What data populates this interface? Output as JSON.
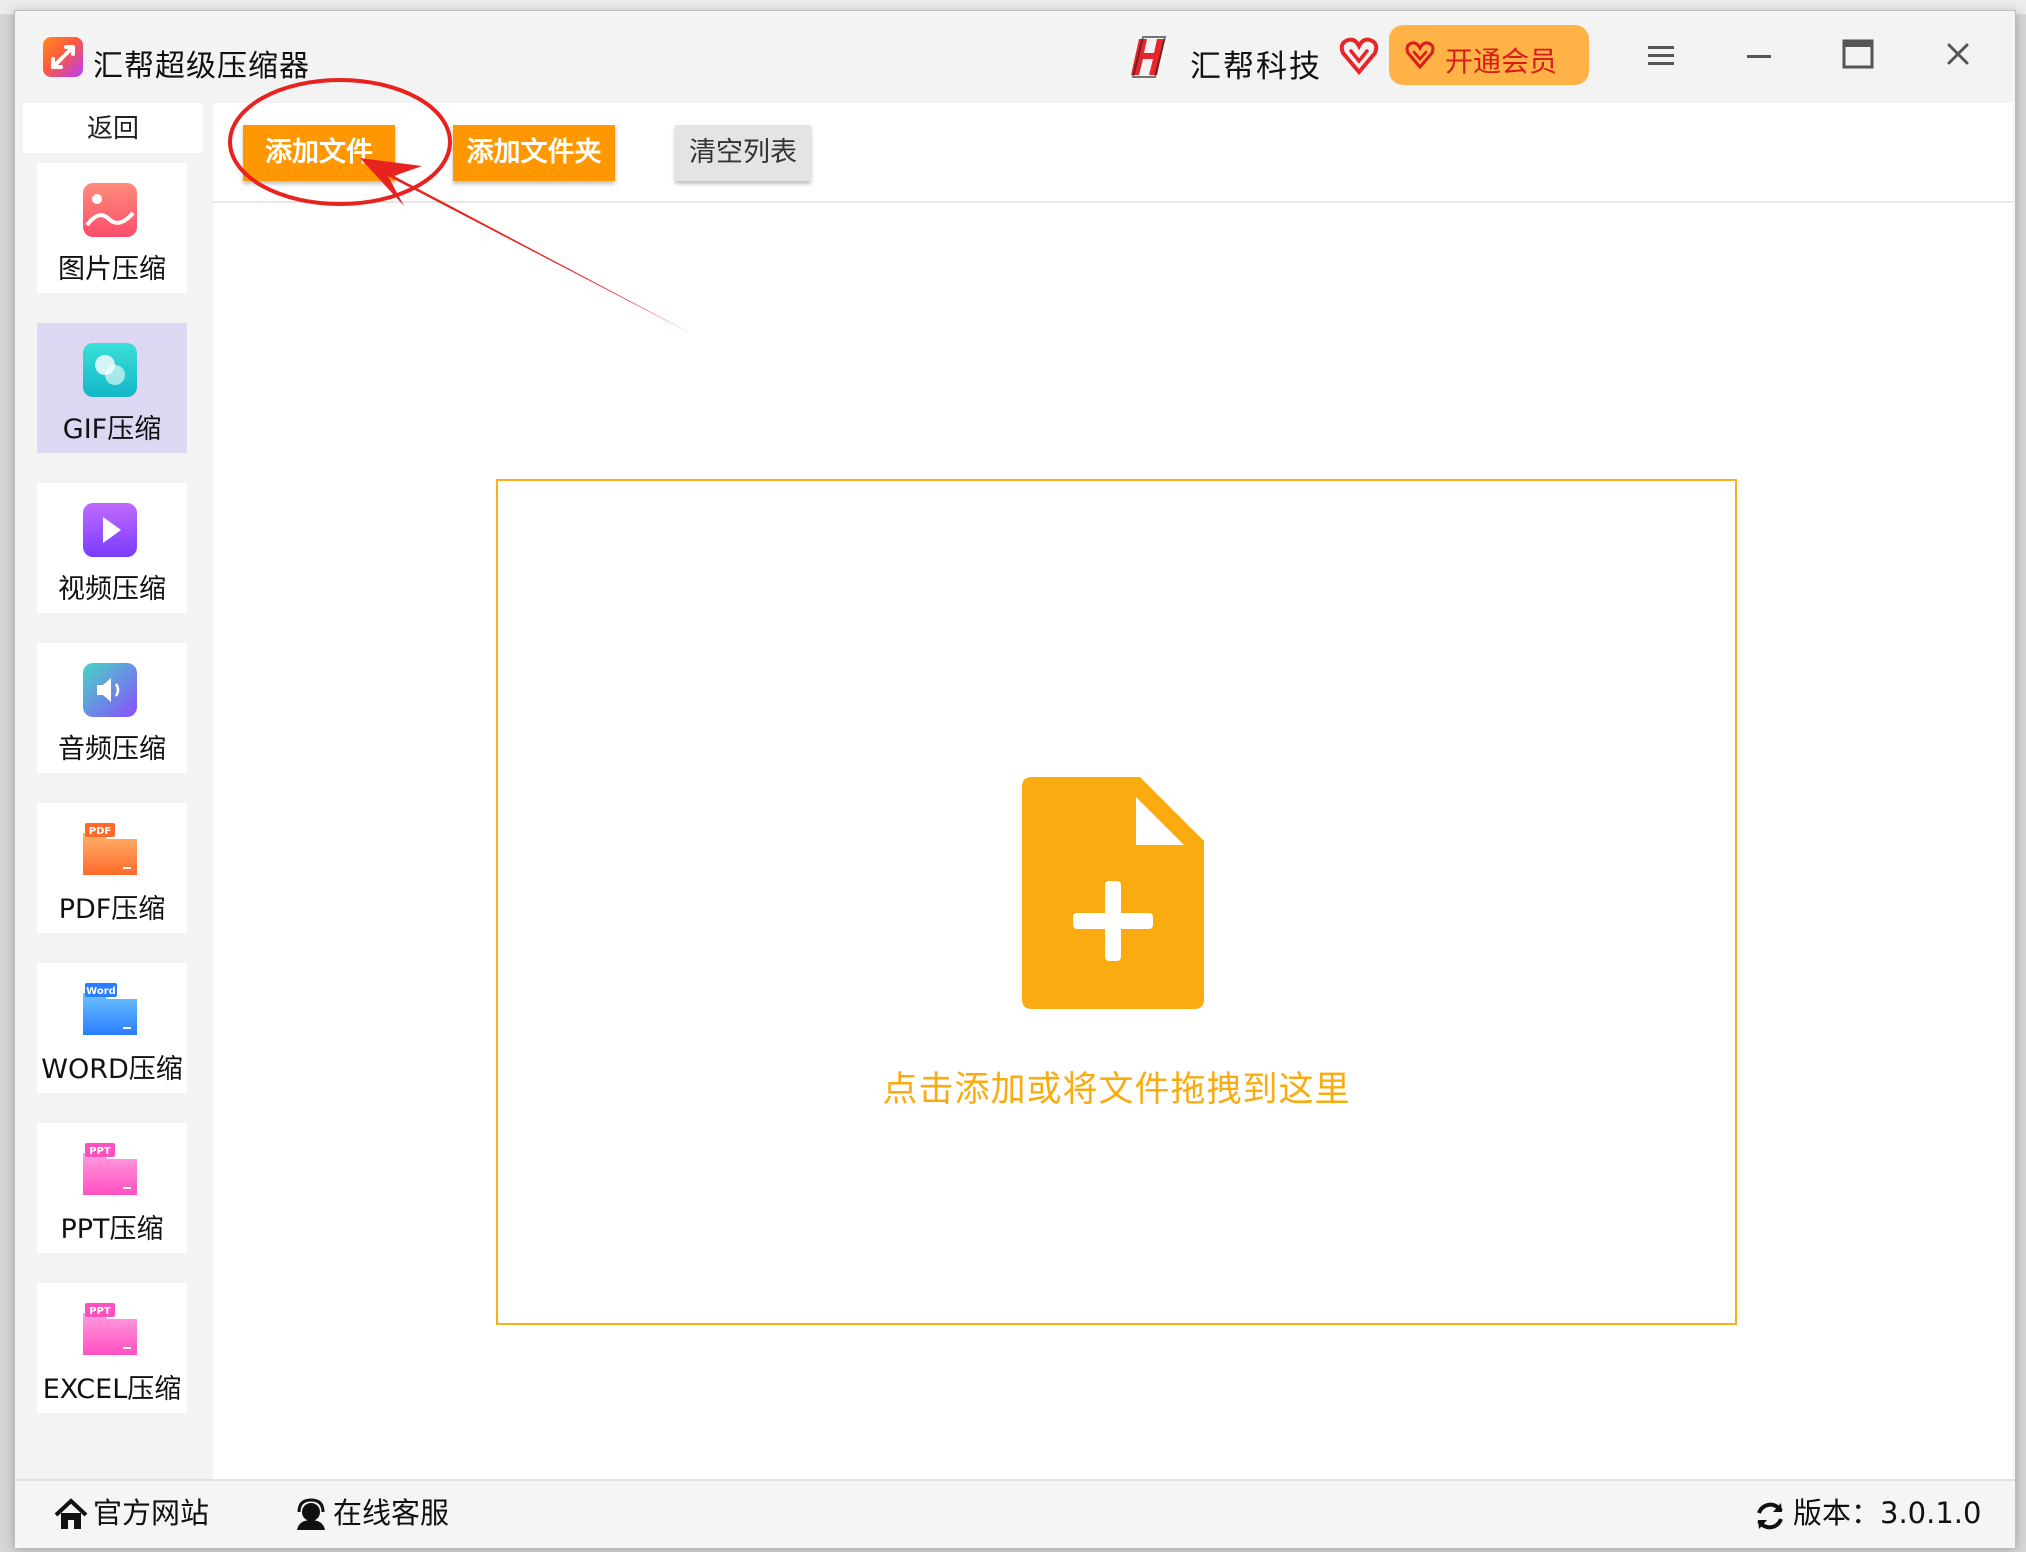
{
  "app": {
    "title": "汇帮超级压缩器",
    "brand_name": "汇帮科技",
    "vip_label": "开通会员",
    "colors": {
      "accent": "#ff9800",
      "drop_border": "#f9ae1c",
      "vip_bg": "#ffb347",
      "active_nav": "#ddd7f3"
    }
  },
  "sidebar": {
    "back_label": "返回",
    "items": [
      {
        "label": "图片压缩",
        "icon": "image-icon",
        "active": false
      },
      {
        "label": "GIF压缩",
        "icon": "gif-icon",
        "active": true
      },
      {
        "label": "视频压缩",
        "icon": "video-icon",
        "active": false
      },
      {
        "label": "音频压缩",
        "icon": "audio-icon",
        "active": false
      },
      {
        "label": "PDF压缩",
        "icon": "pdf-folder-icon",
        "badge": "PDF",
        "active": false
      },
      {
        "label": "WORD压缩",
        "icon": "word-folder-icon",
        "badge": "Word",
        "active": false
      },
      {
        "label": "PPT压缩",
        "icon": "ppt-folder-icon",
        "badge": "PPT",
        "active": false
      },
      {
        "label": "EXCEL压缩",
        "icon": "excel-folder-icon",
        "badge": "PPT",
        "active": false
      }
    ]
  },
  "toolbar": {
    "add_file_label": "添加文件",
    "add_folder_label": "添加文件夹",
    "clear_list_label": "清空列表"
  },
  "drop_zone": {
    "hint": "点击添加或将文件拖拽到这里",
    "icon": "file-add-icon"
  },
  "footer": {
    "website_label": "官方网站",
    "support_label": "在线客服",
    "version_label": "版本：3.0.1.0"
  }
}
